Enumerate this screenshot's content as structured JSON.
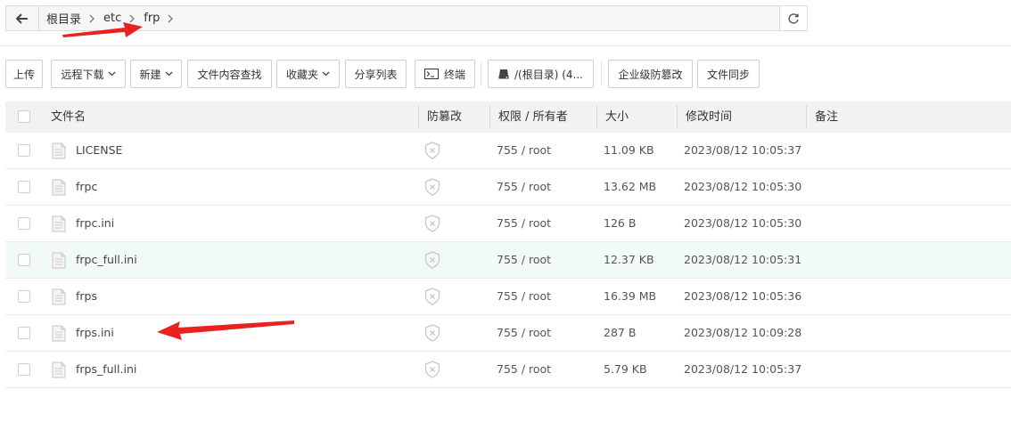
{
  "address_bar": {
    "crumbs": [
      "根目录",
      "etc",
      "frp"
    ]
  },
  "toolbar": {
    "upload": "上传",
    "remote_download": "远程下载",
    "new": "新建",
    "content_search": "文件内容查找",
    "favorites": "收藏夹",
    "share_list": "分享列表",
    "terminal": "终端",
    "disk": "/(根目录) (4...",
    "tamper_proof": "企业级防篡改",
    "file_sync": "文件同步"
  },
  "table": {
    "headers": {
      "name": "文件名",
      "tamper": "防篡改",
      "perm": "权限 / 所有者",
      "size": "大小",
      "mtime": "修改时间",
      "note": "备注"
    },
    "rows": [
      {
        "name": "LICENSE",
        "perm": "755 / root",
        "size": "11.09 KB",
        "mtime": "2023/08/12 10:05:37"
      },
      {
        "name": "frpc",
        "perm": "755 / root",
        "size": "13.62 MB",
        "mtime": "2023/08/12 10:05:30"
      },
      {
        "name": "frpc.ini",
        "perm": "755 / root",
        "size": "126 B",
        "mtime": "2023/08/12 10:05:30"
      },
      {
        "name": "frpc_full.ini",
        "perm": "755 / root",
        "size": "12.37 KB",
        "mtime": "2023/08/12 10:05:31"
      },
      {
        "name": "frps",
        "perm": "755 / root",
        "size": "16.39 MB",
        "mtime": "2023/08/12 10:05:36"
      },
      {
        "name": "frps.ini",
        "perm": "755 / root",
        "size": "287 B",
        "mtime": "2023/08/12 10:09:28"
      },
      {
        "name": "frps_full.ini",
        "perm": "755 / root",
        "size": "5.79 KB",
        "mtime": "2023/08/12 10:05:37"
      }
    ]
  },
  "colors": {
    "annotation_arrow": "#e8231f",
    "hover_row": "#f2faf7",
    "header_bg": "#f2f2f2"
  }
}
